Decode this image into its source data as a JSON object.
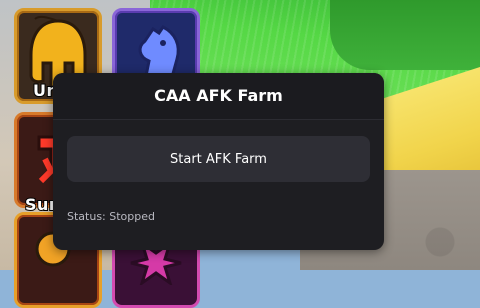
{
  "window": {
    "title": "CAA AFK Farm"
  },
  "controls": {
    "start_label": "Start AFK Farm"
  },
  "status": {
    "text": "Status: Stopped"
  },
  "tiles": {
    "unit_label_partial": "Un",
    "summon_label_partial": "Sum"
  },
  "icons": {
    "spartan_helmet": "spartan-helmet-icon",
    "horse_head": "horse-head-icon",
    "red_summon": "summon-icon",
    "orange_item": "item-icon",
    "pink_item": "emblem-icon"
  }
}
